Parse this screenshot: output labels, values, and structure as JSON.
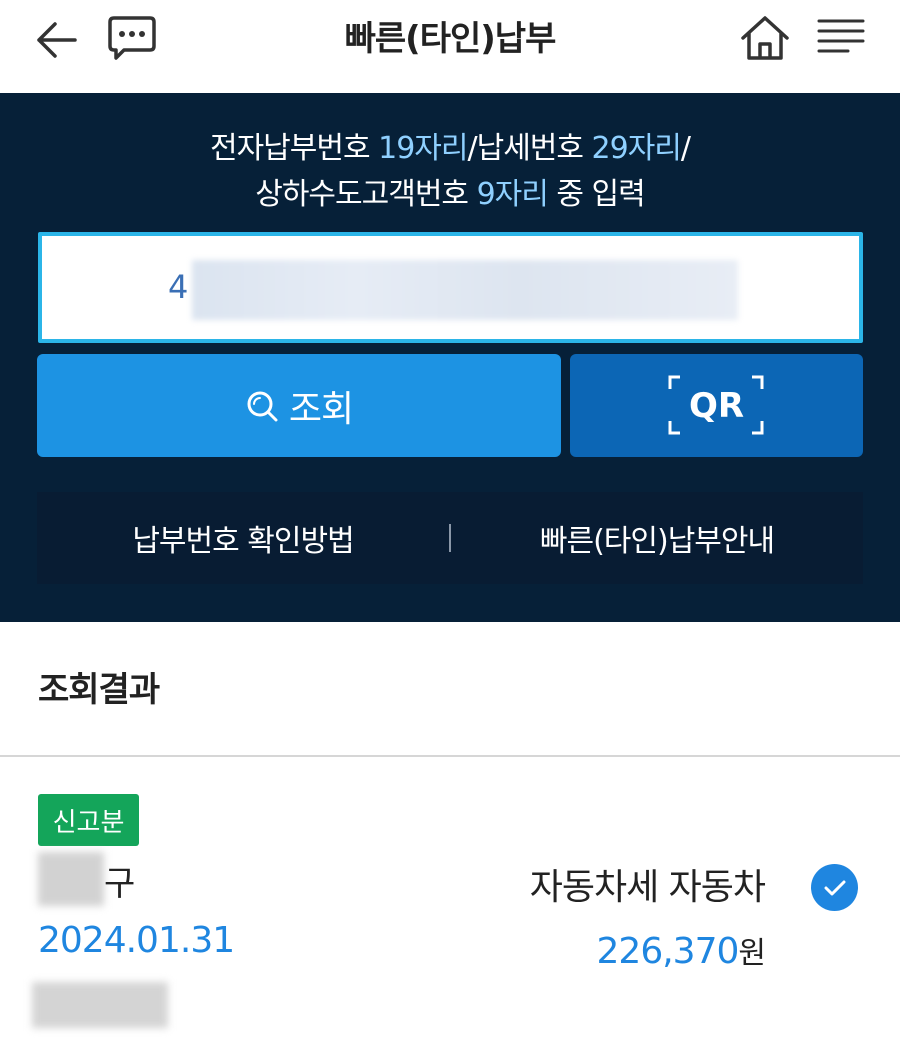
{
  "header": {
    "title": "빠른(타인)납부"
  },
  "panel": {
    "guide": {
      "part1": "전자납부번호 ",
      "part1_hl": "19자리",
      "part2": "/납세번호 ",
      "part2_hl": "29자리",
      "part3": "/",
      "part4": "상하수도고객번호 ",
      "part4_hl": "9자리",
      "part5": " 중 입력"
    },
    "input_prefix": "4",
    "search_label": "조회",
    "qr_label": "QR",
    "link_check_number": "납부번호 확인방법",
    "link_quick_pay_guide": "빠른(타인)납부안내"
  },
  "results": {
    "title": "조회결과",
    "items": [
      {
        "badge": "신고분",
        "region_suffix": "구",
        "tax_type": "자동차세 자동차",
        "date": "2024.01.31",
        "amount": "226,370",
        "amount_unit": "원",
        "checked": true
      }
    ]
  },
  "colors": {
    "panel_bg": "#062038",
    "search_button": "#1d93e3",
    "qr_button": "#0c66b5",
    "accent_blue": "#1f86e0",
    "badge_green": "#14a55a",
    "input_border": "#2bb5e8"
  },
  "icons": {
    "back": "arrow-left-icon",
    "chat": "chat-bubble-icon",
    "home": "home-icon",
    "menu": "hamburger-menu-icon",
    "search": "magnifier-icon",
    "check": "check-circle-icon"
  }
}
